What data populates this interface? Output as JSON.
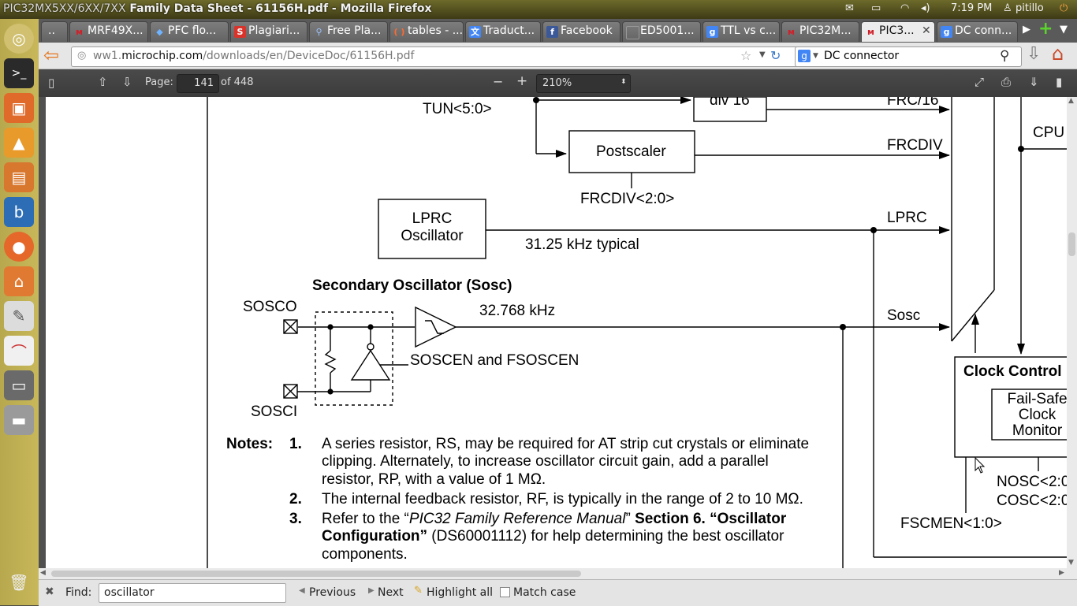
{
  "window": {
    "title_prefix": "PIC32MX5XX/6XX/7XX",
    "title_rest": " Family Data Sheet - 61156H.pdf - Mozilla Firefox"
  },
  "tray": {
    "time": "7:19 PM",
    "user": "pitillo"
  },
  "tabs": [
    {
      "label": "..",
      "icon": "scroll-left-icon"
    },
    {
      "label": "MRF49X...",
      "icon": "microchip-icon",
      "color": "#d0202a"
    },
    {
      "label": "PFC flo...",
      "icon": "dropbox-icon",
      "color": "#2a7fd4"
    },
    {
      "label": "Plagiari...",
      "icon": "s-icon",
      "color": "#d9342b"
    },
    {
      "label": "Free Pla...",
      "icon": "search-icon",
      "color": "#3b6ed6"
    },
    {
      "label": "tables - ...",
      "icon": "brace-icon",
      "color": "#d35400"
    },
    {
      "label": "Traduct...",
      "icon": "translate-icon",
      "color": "#4285f4"
    },
    {
      "label": "Facebook",
      "icon": "facebook-icon",
      "color": "#3b5998"
    },
    {
      "label": "ED5001...",
      "icon": "page-icon",
      "color": "#555555"
    },
    {
      "label": "TTL vs c...",
      "icon": "google-icon",
      "color": "#4285f4"
    },
    {
      "label": "PIC32M...",
      "icon": "microchip-icon",
      "color": "#d0202a"
    },
    {
      "label": "PIC3...",
      "icon": "microchip-icon",
      "color": "#d0202a",
      "active": true
    },
    {
      "label": "DC conn...",
      "icon": "google-icon",
      "color": "#4285f4"
    }
  ],
  "nav": {
    "url_prefix": "ww1.",
    "url_domain": "microchip.com",
    "url_path": "/downloads/en/DeviceDoc/61156H.pdf",
    "search_value": "DC connector"
  },
  "pdf": {
    "page_label": "Page:",
    "page_value": "141",
    "page_total": "of 448",
    "zoom": "210%"
  },
  "diagram": {
    "tun": "TUN<5:0>",
    "div16": "div 16",
    "frc16": "FRC/16",
    "postscaler": "Postscaler",
    "frcdiv": "FRCDIV",
    "frcdiv_sel": "FRCDIV<2:0>",
    "cpu": "CPU",
    "lprc_box_line1": "LPRC",
    "lprc_box_line2": "Oscillator",
    "lprc_freq": "31.25 kHz typical",
    "lprc_out": "LPRC",
    "sosc_title": "Secondary Oscillator (Sosc)",
    "sosco": "SOSCO",
    "sosci": "SOSCI",
    "sosc_freq": "32.768 kHz",
    "sosc_out": "Sosc",
    "soscen": "SOSCEN and FSOSCEN",
    "clock_control": "Clock Control",
    "fsm_line1": "Fail-Safe",
    "fsm_line2": "Clock",
    "fsm_line3": "Monitor",
    "nosc": "NOSC<2:0",
    "cosc": "COSC<2:0",
    "fscmen": "FSCMEN<1:0>"
  },
  "notes": {
    "label": "Notes:",
    "n1_num": "1.",
    "n1_l1": "A series resistor, RS, may be required for AT strip cut crystals or eliminate",
    "n1_l2": "clipping. Alternately, to increase oscillator circuit gain, add a parallel",
    "n1_l3": "resistor, RP, with a value of 1 MΩ.",
    "n2_num": "2.",
    "n2_l1": "The internal feedback resistor, RF, is typically in the range of 2 to 10 MΩ.",
    "n3_num": "3.",
    "n3_a": "Refer to the “",
    "n3_b": "PIC32 Family Reference Manual",
    "n3_c": "” ",
    "n3_d": "Section 6. “Oscillator",
    "n3_l2a": "Configuration”",
    "n3_l2b": " (DS60001112) for help determining the best oscillator",
    "n3_l3": "components."
  },
  "find": {
    "label": "Find:",
    "value": "oscillator",
    "previous": "Previous",
    "next": "Next",
    "highlight": "Highlight all",
    "match_case": "Match case"
  }
}
